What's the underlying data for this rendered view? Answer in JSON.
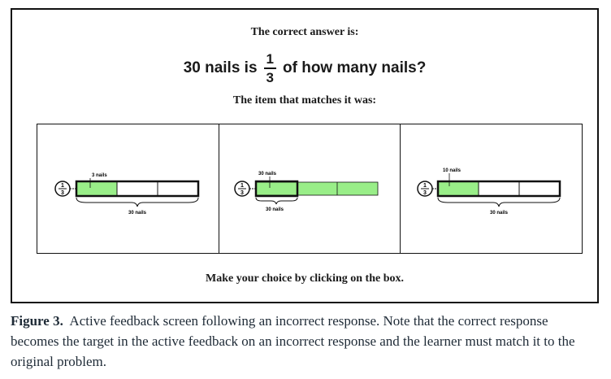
{
  "screen": {
    "correct_heading": "The correct answer is:",
    "question": {
      "prefix": "30 nails is",
      "numerator": "1",
      "denominator": "3",
      "suffix": "of how many nails?"
    },
    "match_heading": "The item that matches it was:",
    "instruction": "Make your choice by clicking on the box."
  },
  "choices": [
    {
      "top_label": "3 nails",
      "bottom_label": "30 nails",
      "circle_num": "1",
      "circle_den": "3"
    },
    {
      "top_label": "30 nails",
      "bottom_label": "30 nails",
      "circle_num": "1",
      "circle_den": "3"
    },
    {
      "top_label": "10 nails",
      "bottom_label": "30 nails",
      "circle_num": "1",
      "circle_den": "3"
    }
  ],
  "colors": {
    "fill_green": "#99ee88",
    "outline": "#111111"
  },
  "caption": {
    "label": "Figure 3.",
    "text": "Active feedback screen following an incorrect response. Note that the correct response becomes the target in the active feedback on an incorrect response and the learner must match it to the original problem."
  }
}
